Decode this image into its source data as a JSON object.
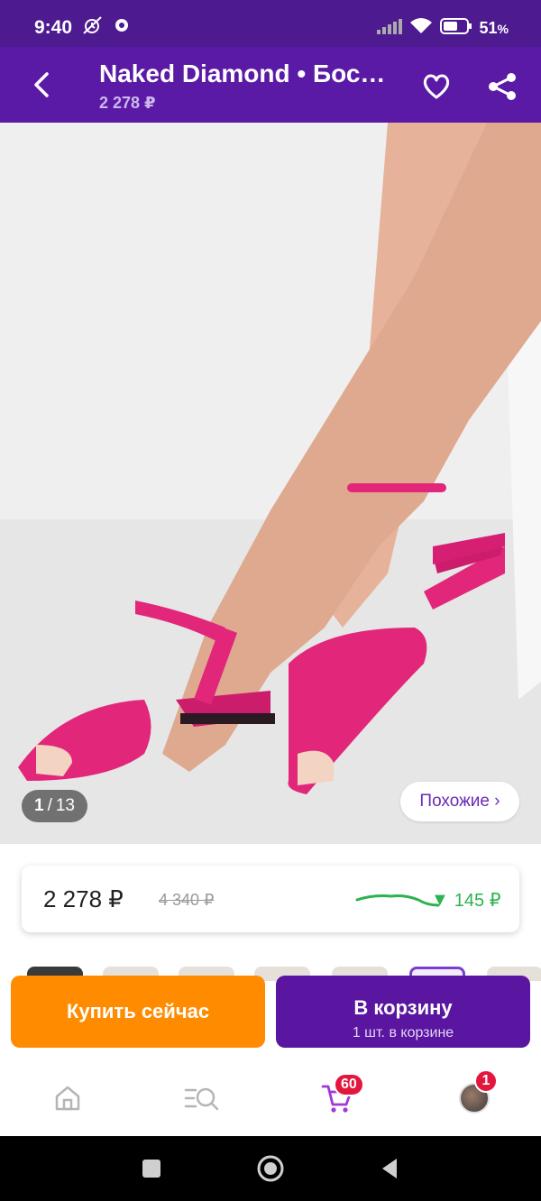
{
  "status_bar": {
    "time": "9:40",
    "battery_percent": "51",
    "battery_unit": "%"
  },
  "app_bar": {
    "title": "Naked Diamond • Бос…",
    "subtitle": "2 278 ₽"
  },
  "gallery": {
    "current": "1",
    "separator": "/",
    "total": "13",
    "similar_label": "Похожие ›"
  },
  "price": {
    "current": "2 278 ₽",
    "old": "4 340 ₽",
    "drop_arrow": "▼",
    "drop": "145 ₽"
  },
  "actions": {
    "buy_now": "Купить сейчас",
    "add_to_cart": "В корзину",
    "in_cart": "1 шт. в корзине"
  },
  "bottom_nav": {
    "cart_badge": "60",
    "profile_badge": "1"
  },
  "colors": {
    "brand": "#5a1aa6",
    "status_bar": "#4d1a8f",
    "buy": "#ff8c00",
    "cart": "#5a16a0",
    "accent_green": "#2ab34e",
    "badge": "#e3163e"
  }
}
